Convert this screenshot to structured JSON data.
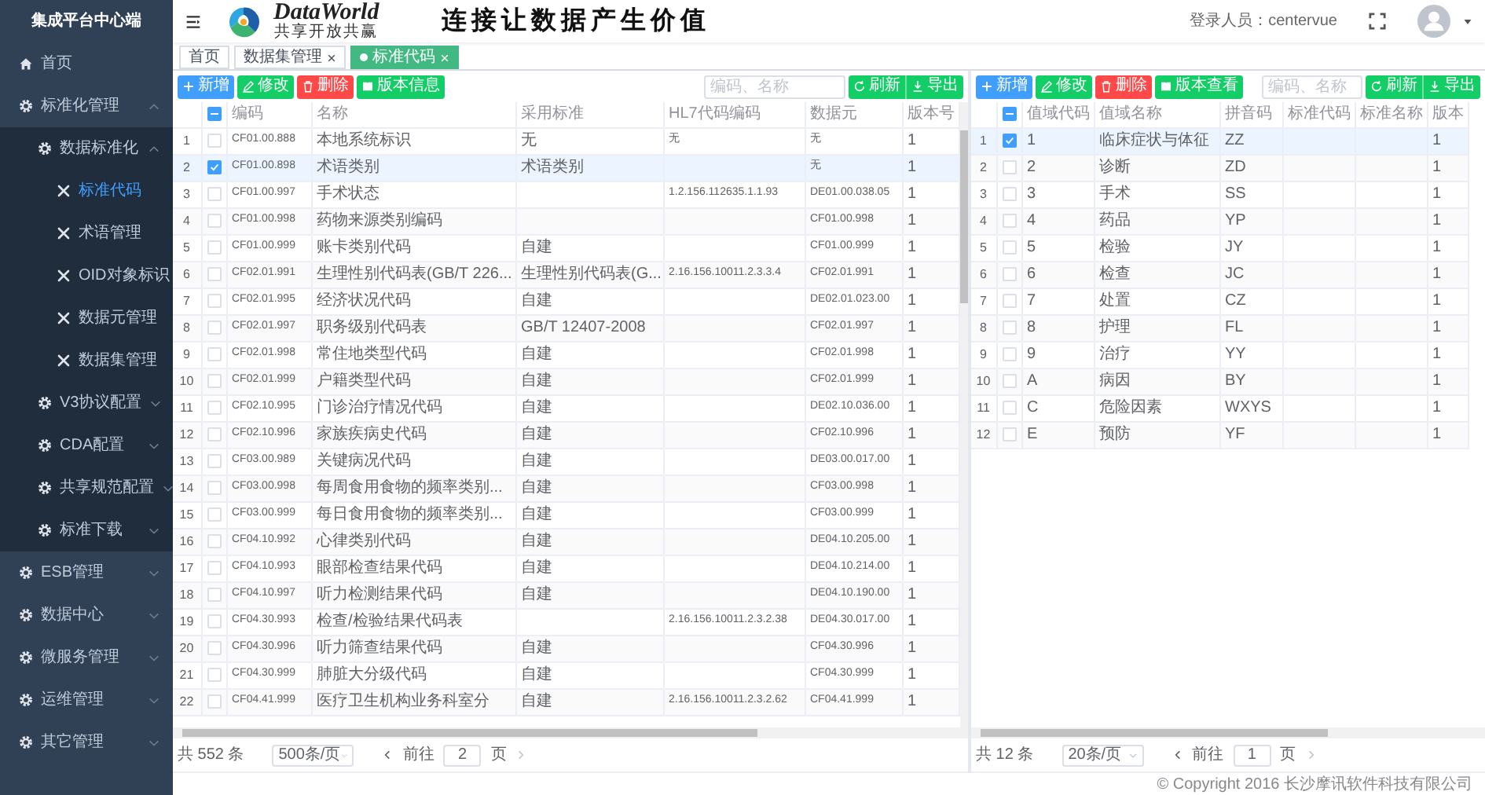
{
  "sidebar": {
    "title": "集成平台中心端",
    "items": [
      {
        "label": "首页",
        "kind": "home",
        "selected": false
      },
      {
        "label": "标准化管理",
        "kind": "group",
        "selected": false,
        "expanded": true,
        "children": [
          {
            "label": "数据标准化",
            "kind": "group",
            "selected": false,
            "expanded": true,
            "children": [
              {
                "label": "标准代码",
                "kind": "page",
                "selected": true
              },
              {
                "label": "术语管理",
                "kind": "page",
                "selected": false
              },
              {
                "label": "OID对象标识",
                "kind": "page",
                "selected": false
              },
              {
                "label": "数据元管理",
                "kind": "page",
                "selected": false
              },
              {
                "label": "数据集管理",
                "kind": "page",
                "selected": false
              }
            ]
          },
          {
            "label": "V3协议配置",
            "kind": "group",
            "selected": false,
            "expanded": false
          },
          {
            "label": "CDA配置",
            "kind": "group",
            "selected": false,
            "expanded": false
          },
          {
            "label": "共享规范配置",
            "kind": "group",
            "selected": false,
            "expanded": false
          },
          {
            "label": "标准下载",
            "kind": "group",
            "selected": false,
            "expanded": false
          }
        ]
      },
      {
        "label": "ESB管理",
        "kind": "group",
        "selected": false,
        "expanded": false
      },
      {
        "label": "数据中心",
        "kind": "group",
        "selected": false,
        "expanded": false
      },
      {
        "label": "微服务管理",
        "kind": "group",
        "selected": false,
        "expanded": false
      },
      {
        "label": "运维管理",
        "kind": "group",
        "selected": false,
        "expanded": false
      },
      {
        "label": "其它管理",
        "kind": "group",
        "selected": false,
        "expanded": false
      }
    ]
  },
  "header": {
    "logo_text": "DataWorld",
    "logo_tagline": "共享开放共赢",
    "slogan": "连接让数据产生价值",
    "user": "登录人员：centervue"
  },
  "tabs": [
    {
      "label": "首页",
      "closable": false,
      "selected": false
    },
    {
      "label": "数据集管理",
      "closable": true,
      "selected": false
    },
    {
      "label": "标准代码",
      "closable": true,
      "selected": true
    }
  ],
  "panels": [
    {
      "buttons": [
        {
          "label": "新增",
          "kind": "add"
        },
        {
          "label": "修改",
          "kind": "edit"
        },
        {
          "label": "删除",
          "kind": "delete"
        },
        {
          "label": "版本信息",
          "kind": "version"
        }
      ],
      "search": {
        "placeholder": "编码、名称"
      },
      "actions": [
        {
          "label": "刷新",
          "kind": "refresh"
        },
        {
          "label": "导出",
          "kind": "export"
        }
      ],
      "table": {
        "partially_checked": true,
        "columns": [
          {
            "label": "编码",
            "kind": "code"
          },
          {
            "label": "名称",
            "kind": "text"
          },
          {
            "label": "采用标准",
            "kind": "text"
          },
          {
            "label": "HL7代码编码",
            "kind": "code"
          },
          {
            "label": "数据元",
            "kind": "code"
          },
          {
            "label": "版本号",
            "kind": "text"
          }
        ],
        "rows": [
          {
            "index": "1",
            "checked": false,
            "cells": [
              "CF01.00.888",
              "本地系统标识",
              "无",
              "无",
              "无",
              "1"
            ]
          },
          {
            "index": "2",
            "checked": true,
            "cells": [
              "CF01.00.898",
              "术语类别",
              "术语类别",
              null,
              "无",
              "1"
            ]
          },
          {
            "index": "3",
            "checked": false,
            "cells": [
              "CF01.00.997",
              "手术状态",
              null,
              "1.2.156.112635.1.1.93",
              "DE01.00.038.05",
              "1"
            ]
          },
          {
            "index": "4",
            "checked": false,
            "cells": [
              "CF01.00.998",
              "药物来源类别编码",
              null,
              null,
              "CF01.00.998",
              "1"
            ]
          },
          {
            "index": "5",
            "checked": false,
            "cells": [
              "CF01.00.999",
              "账卡类别代码",
              "自建",
              null,
              "CF01.00.999",
              "1"
            ]
          },
          {
            "index": "6",
            "checked": false,
            "cells": [
              "CF02.01.991",
              "生理性别代码表(GB/T 226...",
              "生理性别代码表(G...",
              "2.16.156.10011.2.3.3.4",
              "CF02.01.991",
              "1"
            ]
          },
          {
            "index": "7",
            "checked": false,
            "cells": [
              "CF02.01.995",
              "经济状况代码",
              "自建",
              null,
              "DE02.01.023.00",
              "1"
            ]
          },
          {
            "index": "8",
            "checked": false,
            "cells": [
              "CF02.01.997",
              "职务级别代码表",
              "GB/T 12407-2008",
              null,
              "CF02.01.997",
              "1"
            ]
          },
          {
            "index": "9",
            "checked": false,
            "cells": [
              "CF02.01.998",
              "常住地类型代码",
              "自建",
              null,
              "CF02.01.998",
              "1"
            ]
          },
          {
            "index": "10",
            "checked": false,
            "cells": [
              "CF02.01.999",
              "户籍类型代码",
              "自建",
              null,
              "CF02.01.999",
              "1"
            ]
          },
          {
            "index": "11",
            "checked": false,
            "cells": [
              "CF02.10.995",
              "门诊治疗情况代码",
              "自建",
              null,
              "DE02.10.036.00",
              "1"
            ]
          },
          {
            "index": "12",
            "checked": false,
            "cells": [
              "CF02.10.996",
              "家族疾病史代码",
              "自建",
              null,
              "CF02.10.996",
              "1"
            ]
          },
          {
            "index": "13",
            "checked": false,
            "cells": [
              "CF03.00.989",
              "关键病况代码",
              "自建",
              null,
              "DE03.00.017.00",
              "1"
            ]
          },
          {
            "index": "14",
            "checked": false,
            "cells": [
              "CF03.00.998",
              "每周食用食物的频率类别...",
              "自建",
              null,
              "CF03.00.998",
              "1"
            ]
          },
          {
            "index": "15",
            "checked": false,
            "cells": [
              "CF03.00.999",
              "每日食用食物的频率类别...",
              "自建",
              null,
              "CF03.00.999",
              "1"
            ]
          },
          {
            "index": "16",
            "checked": false,
            "cells": [
              "CF04.10.992",
              "心律类别代码",
              "自建",
              null,
              "DE04.10.205.00",
              "1"
            ]
          },
          {
            "index": "17",
            "checked": false,
            "cells": [
              "CF04.10.993",
              "眼部检查结果代码",
              "自建",
              null,
              "DE04.10.214.00",
              "1"
            ]
          },
          {
            "index": "18",
            "checked": false,
            "cells": [
              "CF04.10.997",
              "听力检测结果代码",
              "自建",
              null,
              "DE04.10.190.00",
              "1"
            ]
          },
          {
            "index": "19",
            "checked": false,
            "cells": [
              "CF04.30.993",
              "检查/检验结果代码表",
              null,
              "2.16.156.10011.2.3.2.38",
              "DE04.30.017.00",
              "1"
            ]
          },
          {
            "index": "20",
            "checked": false,
            "cells": [
              "CF04.30.996",
              "听力筛查结果代码",
              "自建",
              null,
              "CF04.30.996",
              "1"
            ]
          },
          {
            "index": "21",
            "checked": false,
            "cells": [
              "CF04.30.999",
              "肺脏大分级代码",
              "自建",
              null,
              "CF04.30.999",
              "1"
            ]
          },
          {
            "index": "22",
            "checked": false,
            "cells": [
              "CF04.41.999",
              "医疗卫生机构业务科室分",
              "自建",
              "2.16.156.10011.2.3.2.62",
              "CF04.41.999",
              "1"
            ]
          }
        ]
      },
      "pagination": {
        "total": "共 552 条",
        "page_size": "500条/页",
        "goto": "前往",
        "page": "2",
        "page_suffix": "页"
      }
    },
    {
      "buttons": [
        {
          "label": "新增",
          "kind": "add"
        },
        {
          "label": "修改",
          "kind": "edit"
        },
        {
          "label": "删除",
          "kind": "delete"
        },
        {
          "label": "版本查看",
          "kind": "version"
        }
      ],
      "search": {
        "placeholder": "编码、名称"
      },
      "actions": [
        {
          "label": "刷新",
          "kind": "refresh"
        },
        {
          "label": "导出",
          "kind": "export"
        }
      ],
      "table": {
        "partially_checked": true,
        "columns": [
          {
            "label": "值域代码",
            "kind": "text"
          },
          {
            "label": "值域名称",
            "kind": "text"
          },
          {
            "label": "拼音码",
            "kind": "text"
          },
          {
            "label": "标准代码",
            "kind": "text"
          },
          {
            "label": "标准名称",
            "kind": "text"
          },
          {
            "label": "版本",
            "kind": "text"
          }
        ],
        "rows": [
          {
            "index": "1",
            "checked": true,
            "cells": [
              "1",
              "临床症状与体征",
              "ZZ",
              null,
              null,
              "1"
            ]
          },
          {
            "index": "2",
            "checked": false,
            "cells": [
              "2",
              "诊断",
              "ZD",
              null,
              null,
              "1"
            ]
          },
          {
            "index": "3",
            "checked": false,
            "cells": [
              "3",
              "手术",
              "SS",
              null,
              null,
              "1"
            ]
          },
          {
            "index": "4",
            "checked": false,
            "cells": [
              "4",
              "药品",
              "YP",
              null,
              null,
              "1"
            ]
          },
          {
            "index": "5",
            "checked": false,
            "cells": [
              "5",
              "检验",
              "JY",
              null,
              null,
              "1"
            ]
          },
          {
            "index": "6",
            "checked": false,
            "cells": [
              "6",
              "检查",
              "JC",
              null,
              null,
              "1"
            ]
          },
          {
            "index": "7",
            "checked": false,
            "cells": [
              "7",
              "处置",
              "CZ",
              null,
              null,
              "1"
            ]
          },
          {
            "index": "8",
            "checked": false,
            "cells": [
              "8",
              "护理",
              "FL",
              null,
              null,
              "1"
            ]
          },
          {
            "index": "9",
            "checked": false,
            "cells": [
              "9",
              "治疗",
              "YY",
              null,
              null,
              "1"
            ]
          },
          {
            "index": "10",
            "checked": false,
            "cells": [
              "A",
              "病因",
              "BY",
              null,
              null,
              "1"
            ]
          },
          {
            "index": "11",
            "checked": false,
            "cells": [
              "C",
              "危险因素",
              "WXYS",
              null,
              null,
              "1"
            ]
          },
          {
            "index": "12",
            "checked": false,
            "cells": [
              "E",
              "预防",
              "YF",
              null,
              null,
              "1"
            ]
          }
        ]
      },
      "pagination": {
        "total": "共 12 条",
        "page_size": "20条/页",
        "goto": "前往",
        "page": "1",
        "page_suffix": "页"
      }
    }
  ],
  "footer": "© Copyright 2016 长沙摩讯软件科技有限公司"
}
